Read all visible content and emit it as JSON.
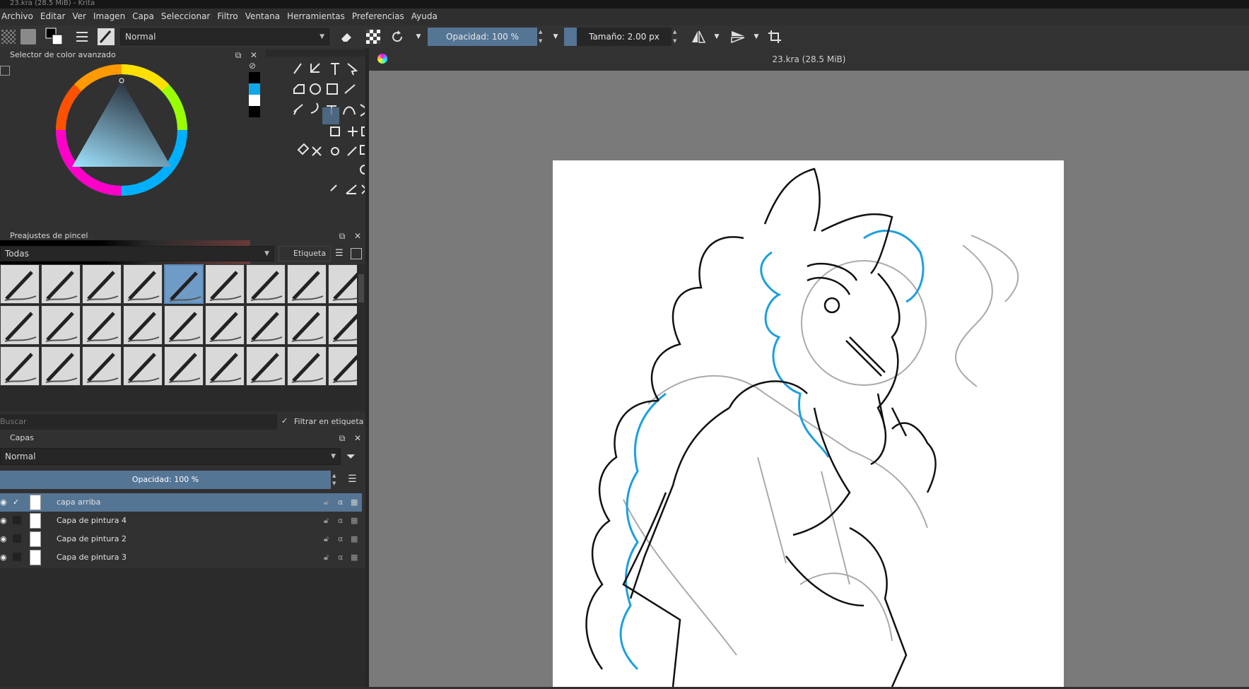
{
  "window": {
    "title": "23.kra (28.5 MiB) - Krita"
  },
  "menu": [
    "Archivo",
    "Editar",
    "Ver",
    "Imagen",
    "Capa",
    "Seleccionar",
    "Filtro",
    "Ventana",
    "Herramientas",
    "Preferencias",
    "Ayuda"
  ],
  "toolbar": {
    "blend_mode": "Normal",
    "opacity": "Opacidad: 100 %",
    "size": "Tamaño: 2.00 px"
  },
  "color_selector": {
    "title": "Selector de color avanzado"
  },
  "brush_presets": {
    "title": "Preajustes de pincel",
    "filter_value": "Todas",
    "tag_label": "Etiqueta",
    "search_placeholder": "Buscar",
    "filter_by_tag": "Filtrar en etiqueta"
  },
  "layers": {
    "title": "Capas",
    "blend_mode": "Normal",
    "opacity_label": "Opacidad:",
    "opacity_value": "100 %",
    "items": [
      {
        "name": "capa arriba",
        "active": true
      },
      {
        "name": "Capa de pintura 4",
        "active": false
      },
      {
        "name": "Capa de pintura 2",
        "active": false
      },
      {
        "name": "Capa de pintura 3",
        "active": false
      }
    ]
  },
  "canvas": {
    "tab_title": "23.kra (28.5 MiB)"
  },
  "colors": {
    "accent": "#557595",
    "selection": "#6f9bc7",
    "canvas_bg": "#7a7a7a",
    "panel_bg": "#313131"
  }
}
